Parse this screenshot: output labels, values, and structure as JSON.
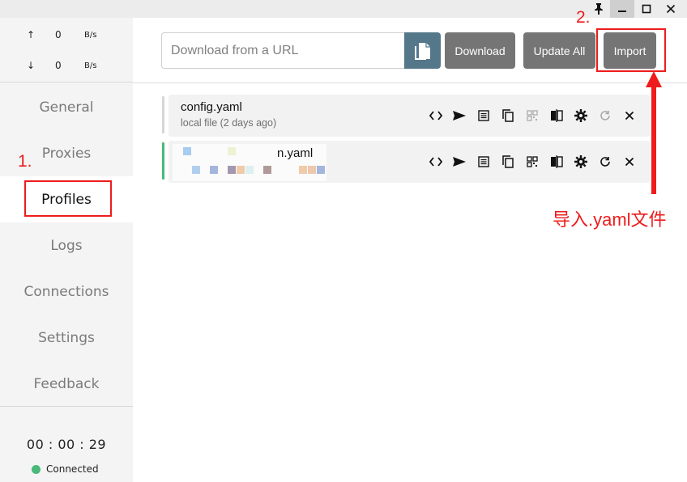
{
  "window": {
    "pin_icon": "pin-icon",
    "minimize_icon": "minimize-icon",
    "maximize_icon": "maximize-icon",
    "close_icon": "close-icon"
  },
  "traffic": {
    "up_arrow": "↑",
    "up_value": "0",
    "up_unit": "B/s",
    "down_arrow": "↓",
    "down_value": "0",
    "down_unit": "B/s"
  },
  "nav": {
    "items": [
      {
        "label": "General"
      },
      {
        "label": "Proxies"
      },
      {
        "label": "Profiles"
      },
      {
        "label": "Logs"
      },
      {
        "label": "Connections"
      },
      {
        "label": "Settings"
      },
      {
        "label": "Feedback"
      }
    ],
    "active": "Profiles"
  },
  "footer": {
    "timer": "00 : 00 : 29",
    "status": "Connected",
    "status_color": "#48b97a"
  },
  "toolbar": {
    "url_placeholder": "Download from a URL",
    "url_value": "",
    "paste_icon": "paste-icon",
    "download_label": "Download",
    "update_all_label": "Update All",
    "import_label": "Import"
  },
  "profiles": [
    {
      "name": "config.yaml",
      "subtitle": "local file (2 days ago)",
      "bar_color": "#d6d6d6"
    },
    {
      "name": "n.yaml",
      "subtitle": "",
      "bar_color": "#48b97a"
    }
  ],
  "card_icons": [
    "code-icon",
    "send-icon",
    "list-icon",
    "copy-icon",
    "qrcode-icon",
    "compare-icon",
    "gear-icon",
    "refresh-icon",
    "close-icon"
  ],
  "annotations": {
    "step1": "1.",
    "step2": "2.",
    "note": "导入.yaml文件",
    "color": "#ee1c1c"
  },
  "colors": {
    "paste_button": "#54778a",
    "action_button": "#757575",
    "sidebar_bg": "#f4f4f4"
  }
}
